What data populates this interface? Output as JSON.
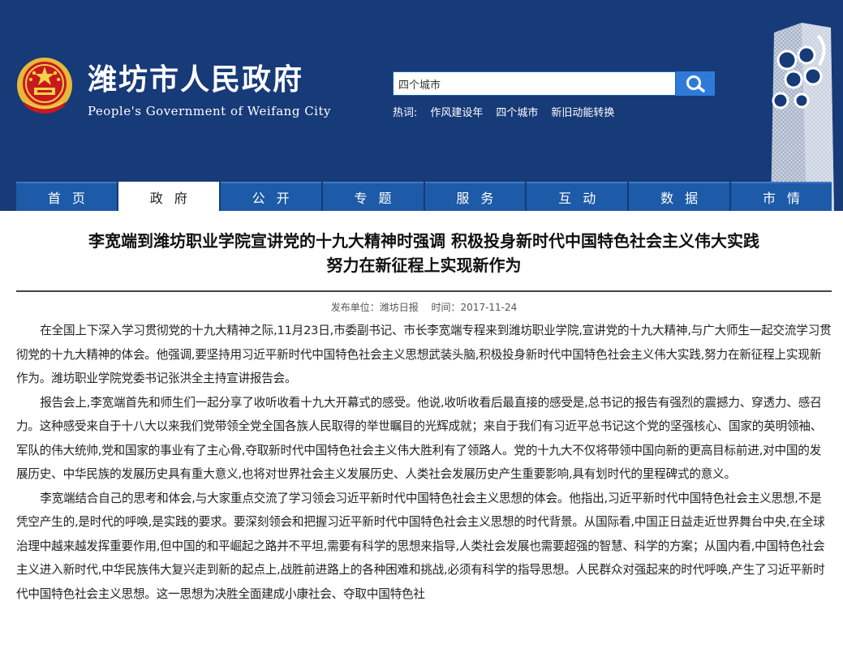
{
  "header": {
    "title": "潍坊市人民政府",
    "subtitle": "People's Government of Weifang City",
    "search": {
      "value": "四个城市"
    },
    "hot": {
      "label": "热词:",
      "items": [
        "作风建设年",
        "四个城市",
        "新旧动能转换"
      ]
    }
  },
  "nav": {
    "items": [
      {
        "label": "首页"
      },
      {
        "label": "政府"
      },
      {
        "label": "公开"
      },
      {
        "label": "专题"
      },
      {
        "label": "服务"
      },
      {
        "label": "互动"
      },
      {
        "label": "数据"
      },
      {
        "label": "市情"
      }
    ],
    "active": "政府"
  },
  "article": {
    "title_line1": "李宽端到潍坊职业学院宣讲党的十九大精神时强调 积极投身新时代中国特色社会主义伟大实践",
    "title_line2": "努力在新征程上实现新作为",
    "publisher": "发布单位：潍坊日报",
    "time": "时间：2017-11-24",
    "paragraphs": [
      "在全国上下深入学习贯彻党的十九大精神之际,11月23日,市委副书记、市长李宽端专程来到潍坊职业学院,宣讲党的十九大精神,与广大师生一起交流学习贯彻党的十九大精神的体会。他强调,要坚持用习近平新时代中国特色社会主义思想武装头脑,积极投身新时代中国特色社会主义伟大实践,努力在新征程上实现新作为。潍坊职业学院党委书记张洪全主持宣讲报告会。",
      "报告会上,李宽端首先和师生们一起分享了收听收看十九大开幕式的感受。他说,收听收看后最直接的感受是,总书记的报告有强烈的震撼力、穿透力、感召力。这种感受来自于十八大以来我们党带领全党全国各族人民取得的举世瞩目的光辉成就；来自于我们有习近平总书记这个党的坚强核心、国家的英明领袖、军队的伟大统帅,党和国家的事业有了主心骨,夺取新时代中国特色社会主义伟大胜利有了领路人。党的十九大不仅将带领中国向新的更高目标前进,对中国的发展历史、中华民族的发展历史具有重大意义,也将对世界社会主义发展历史、人类社会发展历史产生重要影响,具有划时代的里程碑式的意义。",
      "李宽端结合自己的思考和体会,与大家重点交流了学习领会习近平新时代中国特色社会主义思想的体会。他指出,习近平新时代中国特色社会主义思想,不是凭空产生的,是时代的呼唤,是实践的要求。要深刻领会和把握习近平新时代中国特色社会主义思想的时代背景。从国际看,中国正日益走近世界舞台中央,在全球治理中越来越发挥重要作用,但中国的和平崛起之路并不平坦,需要有科学的思想来指导,人类社会发展也需要超强的智慧、科学的方案；从国内看,中国特色社会主义进入新时代,中华民族伟大复兴走到新的起点上,战胜前进路上的各种困难和挑战,必须有科学的指导思想。人民群众对强起来的时代呼唤,产生了习近平新时代中国特色社会主义思想。这一思想为决胜全面建成小康社会、夺取中国特色社"
    ]
  }
}
